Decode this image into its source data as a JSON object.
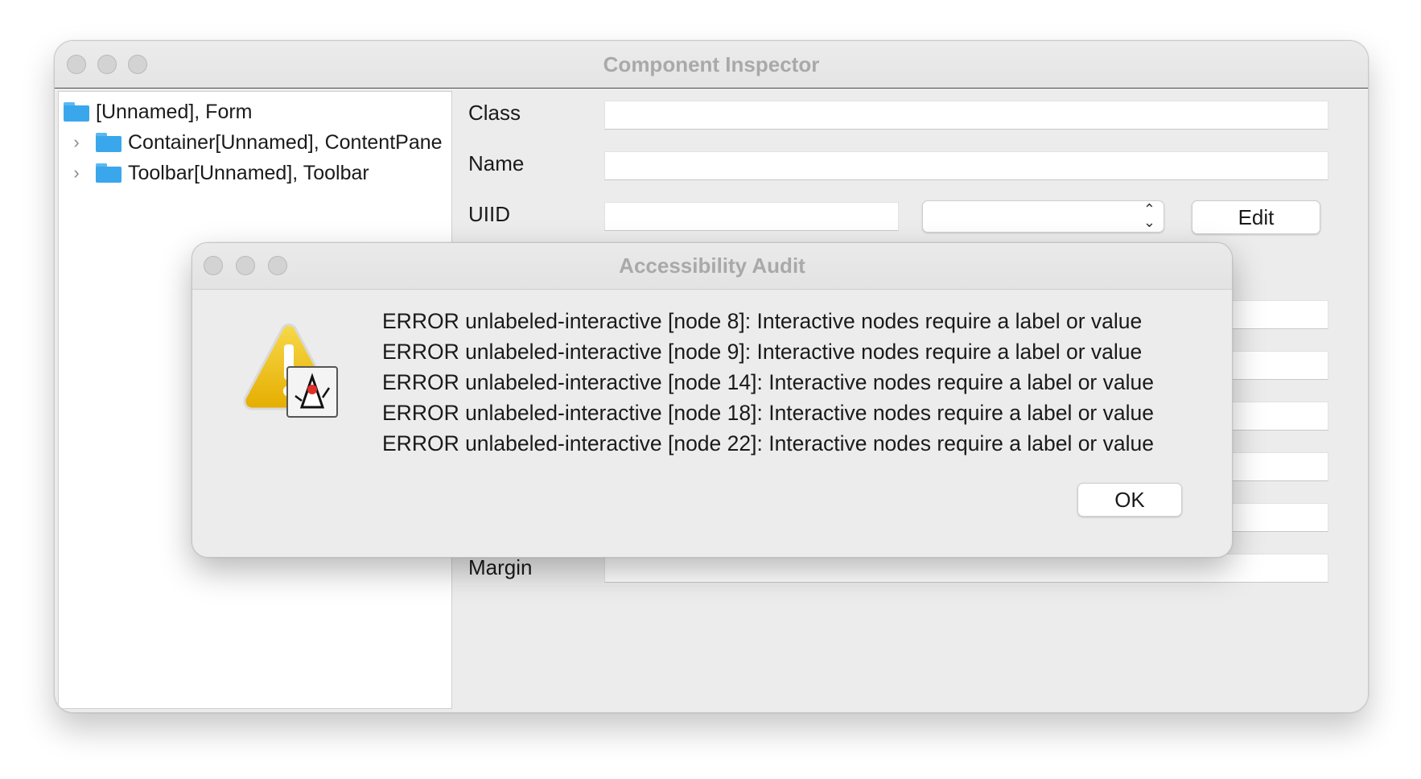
{
  "main_window": {
    "title": "Component Inspector",
    "tree": [
      {
        "label": "[Unnamed], Form",
        "expandable": false
      },
      {
        "label": "Container[Unnamed], ContentPane",
        "expandable": true
      },
      {
        "label": "Toolbar[Unnamed], Toolbar",
        "expandable": true
      }
    ],
    "properties": {
      "class_label": "Class",
      "class_value": "",
      "name_label": "Name",
      "name_value": "",
      "uiid_label": "UIID",
      "uiid_value": "",
      "uiid_select_value": "",
      "edit_button": "Edit",
      "margin_label": "Margin",
      "margin_value": ""
    }
  },
  "dialog": {
    "title": "Accessibility Audit",
    "icon": "warning-java-icon",
    "messages": [
      "ERROR unlabeled-interactive [node 8]: Interactive nodes require a label or value",
      "ERROR unlabeled-interactive [node 9]: Interactive nodes require a label or value",
      "ERROR unlabeled-interactive [node 14]: Interactive nodes require a label or value",
      "ERROR unlabeled-interactive [node 18]: Interactive nodes require a label or value",
      "ERROR unlabeled-interactive [node 22]: Interactive nodes require a label or value"
    ],
    "ok_button": "OK"
  },
  "colors": {
    "window_bg": "#ececec",
    "title_text": "#a9a9a9",
    "folder_blue": "#3aa7ec",
    "warning_yellow": "#f2c200"
  }
}
